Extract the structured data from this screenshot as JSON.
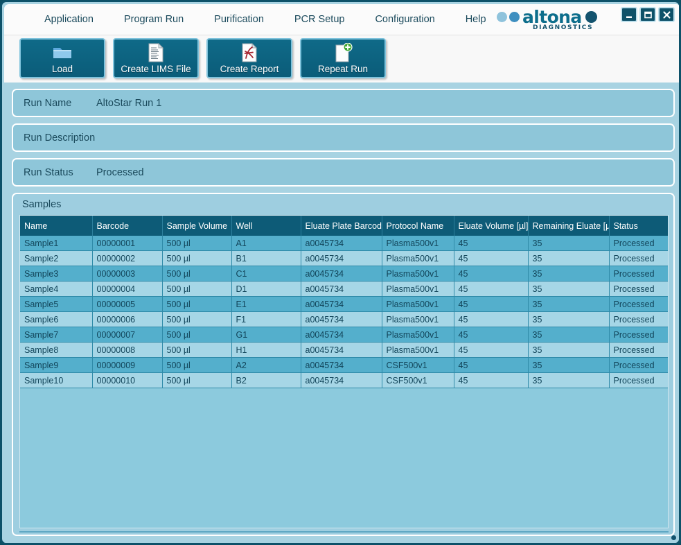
{
  "window": {
    "controls": [
      {
        "name": "minimize",
        "glyph": "minimize-icon"
      },
      {
        "name": "maximize",
        "glyph": "maximize-icon"
      },
      {
        "name": "close",
        "glyph": "close-icon"
      }
    ]
  },
  "brand": {
    "name": "altona",
    "subtitle": "DIAGNOSTICS",
    "colors": {
      "dot_light": "#8fc3dc",
      "dot_medium": "#3e8fc0",
      "dot_dark": "#13536e",
      "wordmark": "#0d6e8c"
    }
  },
  "menu": {
    "items": [
      {
        "label": "Application"
      },
      {
        "label": "Program Run"
      },
      {
        "label": "Purification"
      },
      {
        "label": "PCR Setup"
      },
      {
        "label": "Configuration"
      },
      {
        "label": "Help"
      }
    ]
  },
  "toolbar": {
    "buttons": [
      {
        "label": "Load",
        "icon": "folder-icon"
      },
      {
        "label": "Create LIMS File",
        "icon": "document-lines-icon"
      },
      {
        "label": "Create Report",
        "icon": "pdf-document-icon"
      },
      {
        "label": "Repeat Run",
        "icon": "document-add-icon"
      }
    ]
  },
  "run_info": [
    {
      "label": "Run Name",
      "value": "AltoStar Run 1"
    },
    {
      "label": "Run Description",
      "value": ""
    },
    {
      "label": "Run Status",
      "value": "Processed"
    }
  ],
  "samples": {
    "title": "Samples",
    "columns": [
      "Name",
      "Barcode",
      "Sample Volume",
      "Well",
      "Eluate Plate Barcode",
      "Protocol Name",
      "Eluate Volume [µl]",
      "Remaining Eluate [µl]",
      "Status"
    ],
    "rows": [
      [
        "Sample1",
        "00000001",
        "500 µl",
        "A1",
        "a0045734",
        "Plasma500v1",
        "45",
        "35",
        "Processed"
      ],
      [
        "Sample2",
        "00000002",
        "500 µl",
        "B1",
        "a0045734",
        "Plasma500v1",
        "45",
        "35",
        "Processed"
      ],
      [
        "Sample3",
        "00000003",
        "500 µl",
        "C1",
        "a0045734",
        "Plasma500v1",
        "45",
        "35",
        "Processed"
      ],
      [
        "Sample4",
        "00000004",
        "500 µl",
        "D1",
        "a0045734",
        "Plasma500v1",
        "45",
        "35",
        "Processed"
      ],
      [
        "Sample5",
        "00000005",
        "500 µl",
        "E1",
        "a0045734",
        "Plasma500v1",
        "45",
        "35",
        "Processed"
      ],
      [
        "Sample6",
        "00000006",
        "500 µl",
        "F1",
        "a0045734",
        "Plasma500v1",
        "45",
        "35",
        "Processed"
      ],
      [
        "Sample7",
        "00000007",
        "500 µl",
        "G1",
        "a0045734",
        "Plasma500v1",
        "45",
        "35",
        "Processed"
      ],
      [
        "Sample8",
        "00000008",
        "500 µl",
        "H1",
        "a0045734",
        "Plasma500v1",
        "45",
        "35",
        "Processed"
      ],
      [
        "Sample9",
        "00000009",
        "500 µl",
        "A2",
        "a0045734",
        "CSF500v1",
        "45",
        "35",
        "Processed"
      ],
      [
        "Sample10",
        "00000010",
        "500 µl",
        "B2",
        "a0045734",
        "CSF500v1",
        "45",
        "35",
        "Processed"
      ]
    ]
  },
  "theme": {
    "window_border": "#0d5169",
    "body_bg": "#a8d3e2",
    "panel_bg": "#8ec6d9",
    "table_header_bg": "#0d5b77",
    "row_odd_bg": "#54afcc",
    "row_even_bg": "#a6d6e6",
    "text": "#1b4a5c",
    "toolbar_button_bg": "#0b5c79"
  }
}
